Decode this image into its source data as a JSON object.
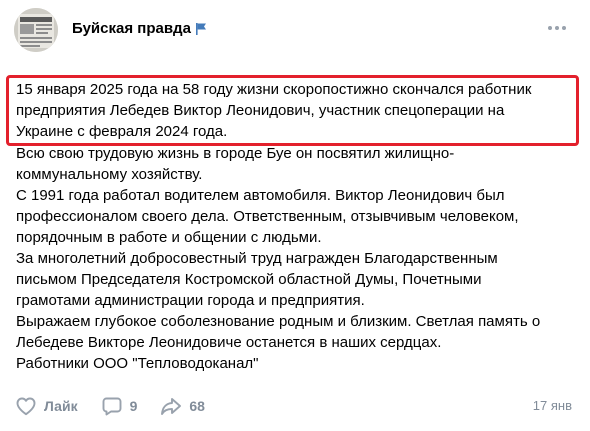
{
  "header": {
    "group_name": "Буйская правда",
    "avatar_icon": "newspaper-avatar",
    "badge_icon": "flag-icon",
    "menu_icon": "more-dots-icon",
    "accent_color": "#447bba"
  },
  "post": {
    "highlight_color": "#e3202c",
    "highlighted_lines": [
      "15 января 2025 года на 58 году жизни скоропостижно скончался работник",
      "предприятия Лебедев Виктор Леонидович, участник спецоперации на",
      "Украине с февраля 2024 года."
    ],
    "paragraphs": [
      [
        "Всю свою трудовую жизнь в городе Буе он посвятил жилищно-",
        "коммунальному хозяйству."
      ],
      [
        "С 1991 года работал водителем автомобиля. Виктор Леонидович был",
        "профессионалом своего дела. Ответственным, отзывчивым человеком,",
        "порядочным в работе и общении с людьми."
      ],
      [
        "За многолетний добросовестный труд награжден Благодарственным",
        "письмом Председателя Костромской областной Думы, Почетными",
        "грамотами администрации города и предприятия."
      ],
      [
        "Выражаем глубокое соболезнование родным и близким. Светлая память о",
        "Лебедеве Викторе Леонидовиче останется в наших сердцах."
      ],
      [
        "Работники ООО \"Тепловодоканал\""
      ]
    ]
  },
  "footer": {
    "like_label": "Лайк",
    "like_icon": "heart-icon",
    "comments_count": "9",
    "comment_icon": "comment-icon",
    "shares_count": "68",
    "share_icon": "share-arrow-icon",
    "date": "17 янв",
    "muted_color": "#818c99"
  }
}
